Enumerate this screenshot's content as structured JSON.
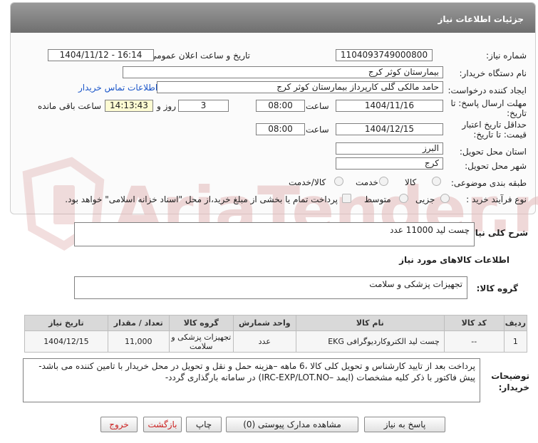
{
  "header": {
    "title": "جزئیات اطلاعات نیاز"
  },
  "fields": {
    "need_number_label": "شماره نیاز:",
    "need_number": "1104093749000800",
    "announce_label": "تاریخ و ساعت اعلان عمومی:",
    "announce_value": "1404/11/12 - 16:14",
    "buyer_label": "نام دستگاه خریدار:",
    "buyer_value": "بیمارستان کوثر کرج",
    "creator_label": "ایجاد کننده درخواست:",
    "creator_value": "حامد مالکی گلی کارپرداز بیمارستان کوثر کرج",
    "contact_link": "اطلاعات تماس خریدار",
    "deadline_label_1": "مهلت ارسال پاسخ: تا",
    "deadline_label_2": "تاریخ:",
    "deadline_date": "1404/11/16",
    "time_label": "ساعت",
    "deadline_time": "08:00",
    "days_value": "3",
    "days_label": "روز و",
    "remaining_time": "14:13:43",
    "remaining_label": "ساعت باقی مانده",
    "validity_label_1": "حداقل تاریخ اعتبار",
    "validity_label_2": "قیمت: تا تاریخ:",
    "validity_date": "1404/12/15",
    "validity_time": "08:00",
    "province_label": "استان محل تحویل:",
    "province_value": "البرز",
    "city_label": "شهر محل تحویل:",
    "city_value": "کرج",
    "category_label": "طبقه بندی موضوعی:",
    "category_options": [
      "کالا",
      "خدمت",
      "کالا/خدمت"
    ],
    "process_label": "نوع فرآیند خرید :",
    "process_options": [
      "جزیی",
      "متوسط"
    ],
    "process_note": "پرداخت تمام یا بخشی از مبلغ خرید،از محل \"اسناد خزانه اسلامی\" خواهد بود."
  },
  "summary": {
    "label": "شرح کلی نیاز:",
    "value": "چست لید 11000 عدد"
  },
  "goods": {
    "section_title": "اطلاعات کالاهای مورد نیاز",
    "group_label": "گروه کالا:",
    "group_value": "تجهیزات پزشکی و سلامت"
  },
  "table": {
    "headers": [
      "ردیف",
      "کد کالا",
      "نام کالا",
      "واحد شمارش",
      "گروه کالا",
      "تعداد / مقدار",
      "تاریخ نیاز"
    ],
    "rows": [
      [
        "1",
        "--",
        "چست لید الکتروکاردیوگرافی EKG",
        "عدد",
        "تجهیزات پزشکی و سلامت",
        "11,000",
        "1404/12/15"
      ]
    ]
  },
  "notes": {
    "label_1": "توضیحات",
    "label_2": "خریدار:",
    "value": "پرداخت بعد از تایید کارشناس و تحویل کلی کالا ،6 ماهه –هزینه حمل و نقل و تحویل در محل خریدار با تامین کننده می باشد-پیش فاکتور با ذکر کلیه مشخصات (ایمد –IRC-EXP/LOT.NO) در سامانه بارگذاری گردد-"
  },
  "buttons": {
    "reply": "پاسخ به نیاز",
    "attachments": "مشاهده مدارک پیوستی (0)",
    "print": "چاپ",
    "back": "بازگشت",
    "exit": "خروج"
  },
  "watermark": {
    "text": "AriaTender.net"
  },
  "colors": {
    "header": "#7d7d7d",
    "link": "#1a55c9",
    "highlight": "#fdfbd2",
    "watermark": "#e2b8b8"
  }
}
